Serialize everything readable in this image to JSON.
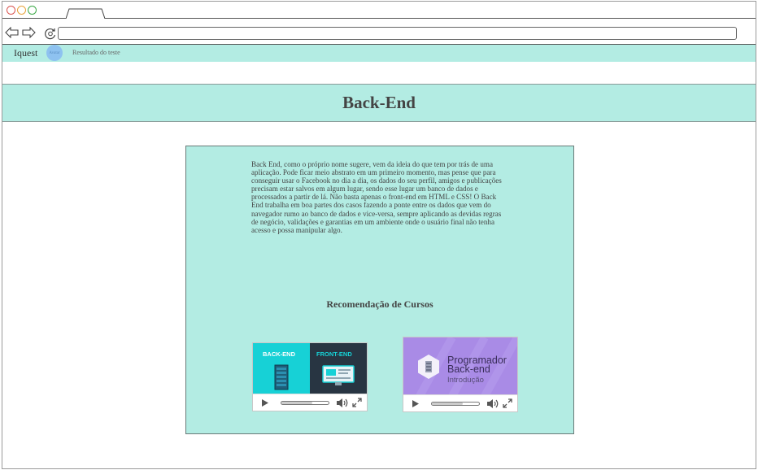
{
  "browser": {
    "url": ""
  },
  "nav": {
    "brand": "Iquest",
    "avatar_label": "Avatar",
    "link": "Resultado do teste"
  },
  "page": {
    "title": "Back-End",
    "description": "Back End, como o próprio nome sugere, vem da ideia do que tem por trás de uma aplicação. Pode ficar meio abstrato em um primeiro momento, mas pense que para conseguir usar o Facebook no dia a dia, os dados do seu perfil, amigos e publicações precisam estar salvos em algum lugar, sendo esse lugar um banco de dados e processados a partir de lá. Não basta apenas o front-end em HTML e CSS! O Back End trabalha em boa partes dos casos fazendo a ponte entre os dados que vem do navegador rumo ao banco de dados e vice-versa, sempre aplicando as devidas regras de negócio, validações e garantias em um ambiente onde o usuário final não tenha acesso e possa manipular algo.",
    "recommendations_title": "Recomendação de Cursos"
  },
  "videos": [
    {
      "thumb_left_label": "BACK-END",
      "thumb_right_label": "FRONT-END",
      "progress": 0.65
    },
    {
      "thumb_title_line1": "Programador",
      "thumb_title_line2": "Back-end",
      "thumb_subtitle": "Introdução",
      "progress": 0.65
    }
  ],
  "colors": {
    "accent": "#b3ece3",
    "video1_left": "#17d1d6",
    "video1_right": "#283542",
    "video2_bg": "#a98be6"
  }
}
